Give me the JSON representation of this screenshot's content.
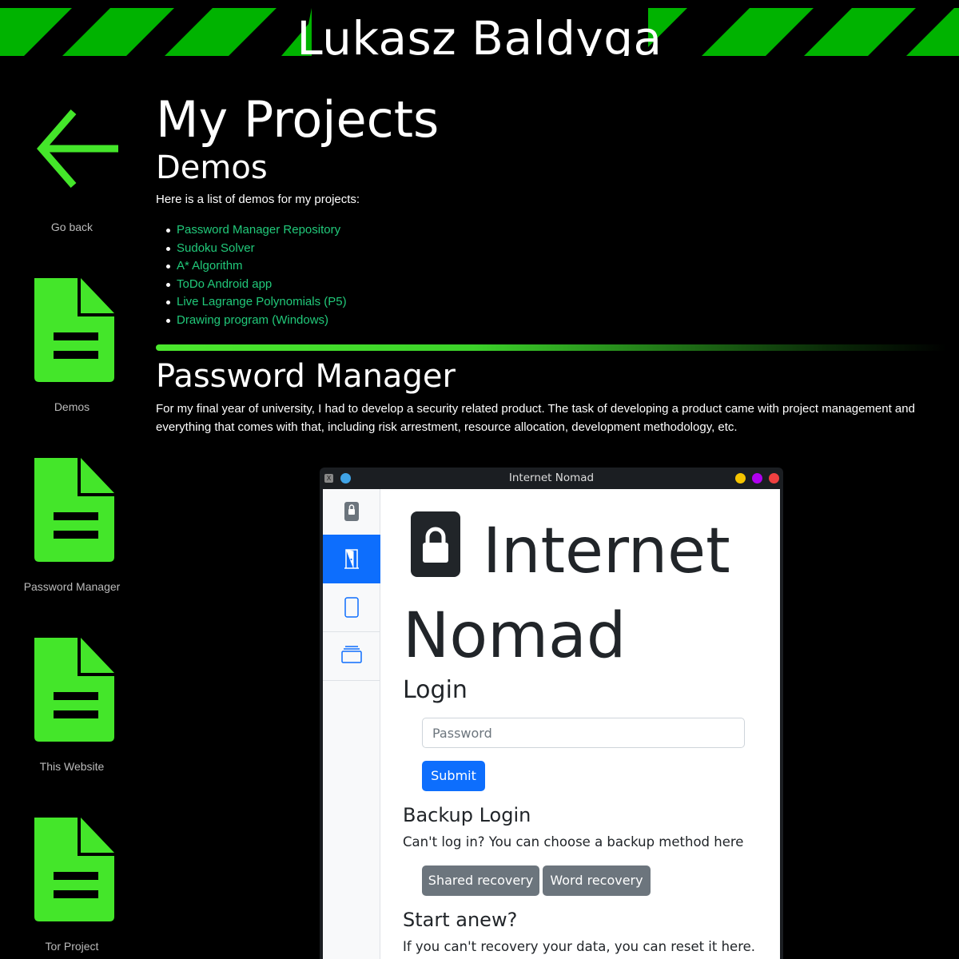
{
  "header": {
    "title": "Lukasz Baldyga",
    "accent_color": "#00b300"
  },
  "sidebar": {
    "items": [
      {
        "label": "Go back",
        "icon": "arrow-left-icon"
      },
      {
        "label": "Demos",
        "icon": "document-icon"
      },
      {
        "label": "Password Manager",
        "icon": "document-icon"
      },
      {
        "label": "This Website",
        "icon": "document-icon"
      },
      {
        "label": "Tor Project",
        "icon": "document-icon"
      }
    ],
    "icon_color": "#44e62a"
  },
  "main": {
    "title": "My Projects",
    "demos": {
      "heading": "Demos",
      "intro": "Here is a list of demos for my projects:",
      "links": [
        "Password Manager Repository",
        "Sudoku Solver",
        "A* Algorithm",
        "ToDo Android app",
        "Live Lagrange Polynomials (P5)",
        "Drawing program (Windows)"
      ],
      "link_color": "#21c97a"
    },
    "password_manager": {
      "heading": "Password Manager",
      "description": "For my final year of university, I had to develop a security related product. The task of developing a product came with project management and everything that comes with that, including risk arrestment, resource allocation, development methodology, etc."
    }
  },
  "app_window": {
    "title": "Internet Nomad",
    "controls": [
      "#f5c400",
      "#b000f0",
      "#f04040"
    ],
    "brand_line1": "Internet",
    "brand_line2": "Nomad",
    "login_heading": "Login",
    "password_placeholder": "Password",
    "submit_label": "Submit",
    "backup_heading": "Backup Login",
    "backup_text": "Can't log in? You can choose a backup method here",
    "shared_recovery_label": "Shared recovery",
    "word_recovery_label": "Word recovery",
    "anew_heading": "Start anew?",
    "anew_text": "If you can't recovery your data, you can reset it here.",
    "nav_icons": [
      "lock-icon",
      "door-icon",
      "tablet-icon",
      "layers-icon"
    ]
  }
}
